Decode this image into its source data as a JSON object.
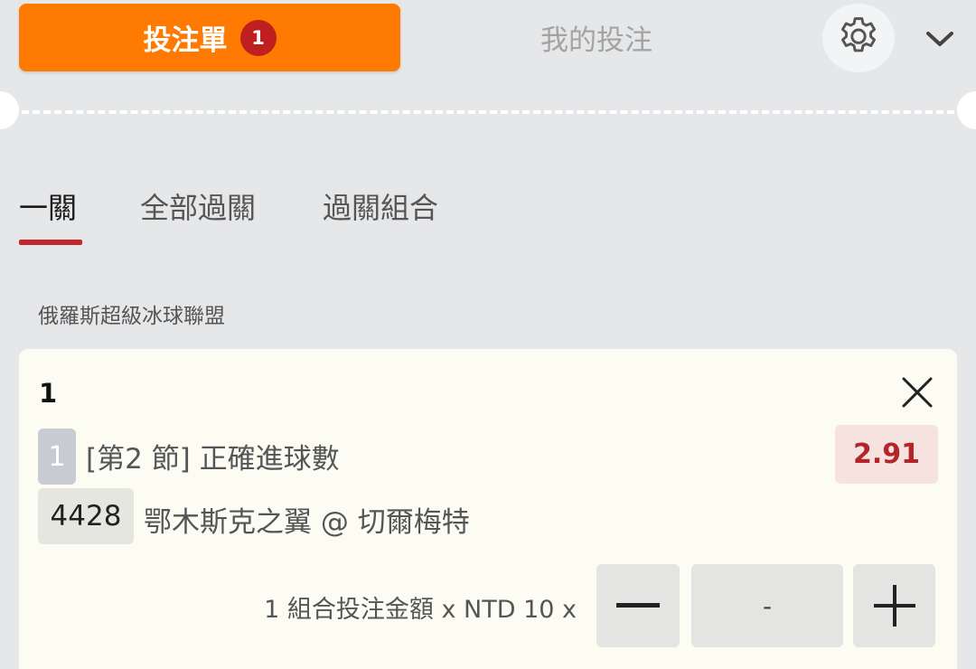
{
  "header": {
    "betslip_label": "投注單",
    "betslip_count": "1",
    "mybets_label": "我的投注",
    "settings_icon": "gear-icon",
    "collapse_icon": "chevron-down-icon"
  },
  "tabs": [
    {
      "label": "一關",
      "active": true
    },
    {
      "label": "全部過關",
      "active": false
    },
    {
      "label": "過關組合",
      "active": false
    }
  ],
  "league": "俄羅斯超級冰球聯盟",
  "bet": {
    "leg_number": "1",
    "leg_badge": "1",
    "market": "[第2 節] 正確進球數",
    "odds": "2.91",
    "match_code": "4428",
    "match": "鄂木斯克之翼 @ 切爾梅特",
    "stake_label": "1 組合投注金額 x NTD 10 x",
    "amount": "-"
  },
  "colors": {
    "accent": "#ff7a00",
    "badge": "#c01f1f",
    "active_underline": "#c0282d",
    "odds_text": "#b2262a"
  }
}
